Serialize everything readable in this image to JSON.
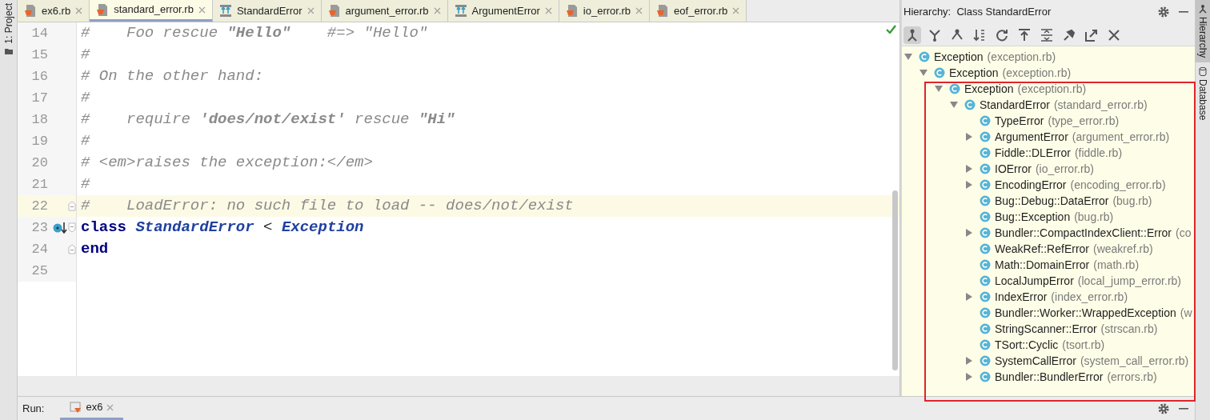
{
  "project_strip": {
    "label": "1: Project"
  },
  "tabs": [
    {
      "label": "ex6.rb",
      "kind": "file",
      "selected": false
    },
    {
      "label": "standard_error.rb",
      "kind": "file",
      "selected": true
    },
    {
      "label": "StandardError",
      "kind": "hierarchy",
      "selected": false
    },
    {
      "label": "argument_error.rb",
      "kind": "file",
      "selected": false
    },
    {
      "label": "ArgumentError",
      "kind": "hierarchy",
      "selected": false
    },
    {
      "label": "io_error.rb",
      "kind": "file",
      "selected": false
    },
    {
      "label": "eof_error.rb",
      "kind": "file",
      "selected": false
    }
  ],
  "editor": {
    "lines": [
      {
        "number": "14",
        "current": false,
        "tokens": [
          {
            "text": "#    Foo rescue ",
            "kind": "comment"
          },
          {
            "text": "\"Hello\"",
            "kind": "comment_bold"
          },
          {
            "text": "    #=> \"Hello\"",
            "kind": "comment"
          }
        ]
      },
      {
        "number": "15",
        "current": false,
        "tokens": [
          {
            "text": "#",
            "kind": "comment"
          }
        ]
      },
      {
        "number": "16",
        "current": false,
        "tokens": [
          {
            "text": "# On the other hand:",
            "kind": "comment"
          }
        ]
      },
      {
        "number": "17",
        "current": false,
        "tokens": [
          {
            "text": "#",
            "kind": "comment"
          }
        ]
      },
      {
        "number": "18",
        "current": false,
        "tokens": [
          {
            "text": "#    require ",
            "kind": "comment"
          },
          {
            "text": "'does/not/exist'",
            "kind": "comment_bold"
          },
          {
            "text": " rescue ",
            "kind": "comment"
          },
          {
            "text": "\"Hi\"",
            "kind": "comment_bold"
          }
        ]
      },
      {
        "number": "19",
        "current": false,
        "tokens": [
          {
            "text": "#",
            "kind": "comment"
          }
        ]
      },
      {
        "number": "20",
        "current": false,
        "tokens": [
          {
            "text": "# <em>raises the exception:</em>",
            "kind": "comment"
          }
        ]
      },
      {
        "number": "21",
        "current": false,
        "tokens": [
          {
            "text": "#",
            "kind": "comment"
          }
        ]
      },
      {
        "number": "22",
        "current": true,
        "fold_end": true,
        "tokens": [
          {
            "text": "#    LoadError: no such file to load -- does/not/exist",
            "kind": "comment"
          }
        ]
      },
      {
        "number": "23",
        "current": false,
        "fold_start": true,
        "subclass_marker": true,
        "tokens": [
          {
            "text": "class",
            "kind": "keyword"
          },
          {
            "text": " StandardError",
            "kind": "constant"
          },
          {
            "text": " < ",
            "kind": "plain"
          },
          {
            "text": "Exception",
            "kind": "constant"
          }
        ]
      },
      {
        "number": "24",
        "current": false,
        "fold_end": true,
        "tokens": [
          {
            "text": "end",
            "kind": "keyword"
          }
        ]
      },
      {
        "number": "25",
        "current": false
      }
    ]
  },
  "hierarchy": {
    "title": "Hierarchy:  Class StandardError",
    "toolbar": [
      {
        "selected": true
      },
      {
        "selected": false
      },
      {
        "selected": false
      },
      {
        "selected": false
      },
      {
        "selected": false
      },
      {
        "selected": false
      },
      {
        "selected": false
      },
      {
        "selected": false
      },
      {
        "selected": false
      },
      {
        "selected": false
      }
    ],
    "tree": [
      {
        "name": "Exception",
        "file": "(exception.rb)",
        "expanded": true,
        "children": [
          {
            "name": "Exception",
            "file": "(exception.rb)",
            "expanded": true,
            "children": [
              {
                "name": "Exception",
                "file": "(exception.rb)",
                "expanded": true,
                "children": [
                  {
                    "name": "StandardError",
                    "file": "(standard_error.rb)",
                    "expanded": true,
                    "children": [
                      {
                        "name": "TypeError",
                        "file": "(type_error.rb)"
                      },
                      {
                        "name": "ArgumentError",
                        "file": "(argument_error.rb)",
                        "expanded": false
                      },
                      {
                        "name": "Fiddle::DLError",
                        "file": "(fiddle.rb)"
                      },
                      {
                        "name": "IOError",
                        "file": "(io_error.rb)",
                        "expanded": false
                      },
                      {
                        "name": "EncodingError",
                        "file": "(encoding_error.rb)",
                        "expanded": false
                      },
                      {
                        "name": "Bug::Debug::DataError",
                        "file": "(bug.rb)"
                      },
                      {
                        "name": "Bug::Exception",
                        "file": "(bug.rb)"
                      },
                      {
                        "name": "Bundler::CompactIndexClient::Error",
                        "file": "(co",
                        "expanded": false
                      },
                      {
                        "name": "WeakRef::RefError",
                        "file": "(weakref.rb)"
                      },
                      {
                        "name": "Math::DomainError",
                        "file": "(math.rb)"
                      },
                      {
                        "name": "LocalJumpError",
                        "file": "(local_jump_error.rb)"
                      },
                      {
                        "name": "IndexError",
                        "file": "(index_error.rb)",
                        "expanded": false
                      },
                      {
                        "name": "Bundler::Worker::WrappedException",
                        "file": "(w"
                      },
                      {
                        "name": "StringScanner::Error",
                        "file": "(strscan.rb)"
                      },
                      {
                        "name": "TSort::Cyclic",
                        "file": "(tsort.rb)"
                      },
                      {
                        "name": "SystemCallError",
                        "file": "(system_call_error.rb)",
                        "expanded": false
                      },
                      {
                        "name": "Bundler::BundlerError",
                        "file": "(errors.rb)",
                        "expanded": false
                      }
                    ]
                  }
                ]
              }
            ]
          }
        ]
      }
    ]
  },
  "side_tabs": [
    {
      "label": "Hierarchy",
      "selected": true
    },
    {
      "label": "Database",
      "selected": false
    }
  ],
  "run_bar": {
    "label": "Run:",
    "tabs": [
      {
        "label": "ex6",
        "selected": true
      }
    ]
  }
}
